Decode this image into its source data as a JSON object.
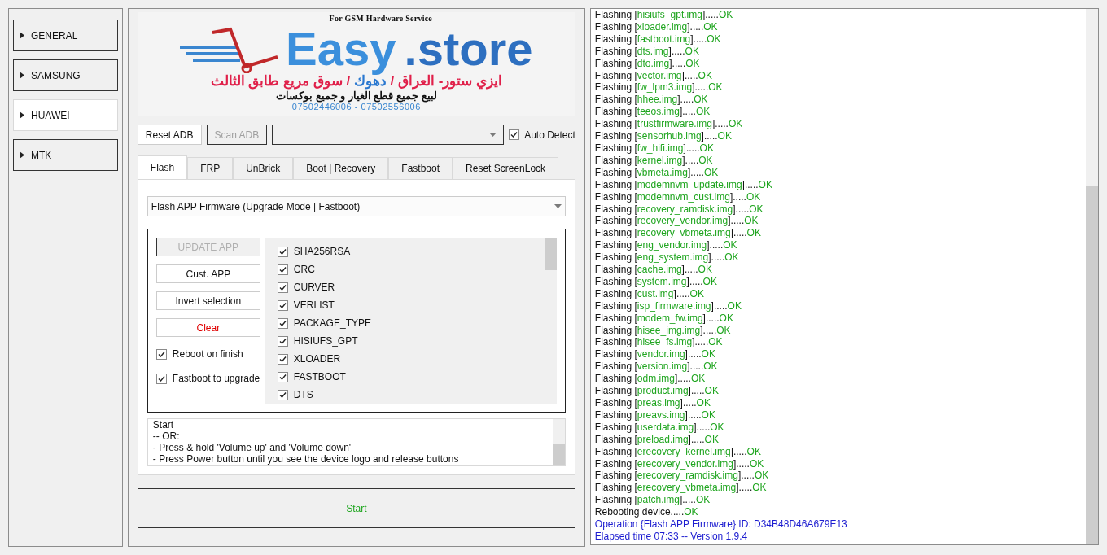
{
  "sidebar": {
    "items": [
      {
        "label": "GENERAL",
        "selected": false
      },
      {
        "label": "SAMSUNG",
        "selected": false
      },
      {
        "label": "HUAWEI",
        "selected": true
      },
      {
        "label": "MTK",
        "selected": false
      }
    ]
  },
  "logo": {
    "tagline": "For GSM Hardware Service",
    "brand": "Easy",
    "brand_suffix": ".store",
    "address_start": "ايزي ستور- العراق /",
    "address_city": "دهوك",
    "address_end": "/ سوق مريع طابق الثالث",
    "slogan": "لبيع جميع قطع الغيار و جميع بوكسات",
    "phones": "07502446006 - 07502556006"
  },
  "toolbar": {
    "buttons": [
      {
        "label": "Reset ADB",
        "disabled": false
      },
      {
        "label": "Scan ADB",
        "disabled": true
      }
    ],
    "auto_detect": {
      "label": "Auto Detect",
      "checked": true
    }
  },
  "tabs": [
    {
      "label": "Flash",
      "selected": true
    },
    {
      "label": "FRP",
      "selected": false
    },
    {
      "label": "UnBrick",
      "selected": false
    },
    {
      "label": "Boot | Recovery",
      "selected": false
    },
    {
      "label": "Fastboot",
      "selected": false
    },
    {
      "label": "Reset ScreenLock",
      "selected": false
    }
  ],
  "mode_select": {
    "value": "Flash APP Firmware (Upgrade Mode | Fastboot)"
  },
  "actions": [
    {
      "label": "UPDATE APP",
      "disabled": true,
      "kind": "normal"
    },
    {
      "label": "Cust. APP",
      "disabled": false,
      "kind": "normal"
    },
    {
      "label": "Invert selection",
      "disabled": false,
      "kind": "normal"
    },
    {
      "label": "Clear",
      "disabled": false,
      "kind": "danger"
    }
  ],
  "options": [
    {
      "label": "Reboot on finish",
      "checked": true
    },
    {
      "label": "Fastboot to upgrade",
      "checked": true
    }
  ],
  "partitions": [
    {
      "label": "SHA256RSA",
      "checked": true
    },
    {
      "label": "CRC",
      "checked": true
    },
    {
      "label": "CURVER",
      "checked": true
    },
    {
      "label": "VERLIST",
      "checked": true
    },
    {
      "label": "PACKAGE_TYPE",
      "checked": true
    },
    {
      "label": "HISIUFS_GPT",
      "checked": true
    },
    {
      "label": "XLOADER",
      "checked": true
    },
    {
      "label": "FASTBOOT",
      "checked": true
    },
    {
      "label": "DTS",
      "checked": true
    }
  ],
  "instructions": [
    "Start",
    "-- OR:",
    "- Press & hold 'Volume up' and 'Volume down'",
    "- Press Power button until you see the device logo and release buttons"
  ],
  "start_button": {
    "label": "Start"
  },
  "log": [
    {
      "kind": "flash",
      "head": "Flashing [",
      "file": "hisiufs_gpt.img",
      "tail": "].....",
      "status": "OK"
    },
    {
      "kind": "flash",
      "head": "Flashing [",
      "file": "xloader.img",
      "tail": "].....",
      "status": "OK"
    },
    {
      "kind": "flash",
      "head": "Flashing [",
      "file": "fastboot.img",
      "tail": "].....",
      "status": "OK"
    },
    {
      "kind": "flash",
      "head": "Flashing [",
      "file": "dts.img",
      "tail": "].....",
      "status": "OK"
    },
    {
      "kind": "flash",
      "head": "Flashing [",
      "file": "dto.img",
      "tail": "].....",
      "status": "OK"
    },
    {
      "kind": "flash",
      "head": "Flashing [",
      "file": "vector.img",
      "tail": "].....",
      "status": "OK"
    },
    {
      "kind": "flash",
      "head": "Flashing [",
      "file": "fw_lpm3.img",
      "tail": "].....",
      "status": "OK"
    },
    {
      "kind": "flash",
      "head": "Flashing [",
      "file": "hhee.img",
      "tail": "].....",
      "status": "OK"
    },
    {
      "kind": "flash",
      "head": "Flashing [",
      "file": "teeos.img",
      "tail": "].....",
      "status": "OK"
    },
    {
      "kind": "flash",
      "head": "Flashing [",
      "file": "trustfirmware.img",
      "tail": "].....",
      "status": "OK"
    },
    {
      "kind": "flash",
      "head": "Flashing [",
      "file": "sensorhub.img",
      "tail": "].....",
      "status": "OK"
    },
    {
      "kind": "flash",
      "head": "Flashing [",
      "file": "fw_hifi.img",
      "tail": "].....",
      "status": "OK"
    },
    {
      "kind": "flash",
      "head": "Flashing [",
      "file": "kernel.img",
      "tail": "].....",
      "status": "OK"
    },
    {
      "kind": "flash",
      "head": "Flashing [",
      "file": "vbmeta.img",
      "tail": "].....",
      "status": "OK"
    },
    {
      "kind": "flash",
      "head": "Flashing [",
      "file": "modemnvm_update.img",
      "tail": "].....",
      "status": "OK"
    },
    {
      "kind": "flash",
      "head": "Flashing [",
      "file": "modemnvm_cust.img",
      "tail": "].....",
      "status": "OK"
    },
    {
      "kind": "flash",
      "head": "Flashing [",
      "file": "recovery_ramdisk.img",
      "tail": "].....",
      "status": "OK"
    },
    {
      "kind": "flash",
      "head": "Flashing [",
      "file": "recovery_vendor.img",
      "tail": "].....",
      "status": "OK"
    },
    {
      "kind": "flash",
      "head": "Flashing [",
      "file": "recovery_vbmeta.img",
      "tail": "].....",
      "status": "OK"
    },
    {
      "kind": "flash",
      "head": "Flashing [",
      "file": "eng_vendor.img",
      "tail": "].....",
      "status": "OK"
    },
    {
      "kind": "flash",
      "head": "Flashing [",
      "file": "eng_system.img",
      "tail": "].....",
      "status": "OK"
    },
    {
      "kind": "flash",
      "head": "Flashing [",
      "file": "cache.img",
      "tail": "].....",
      "status": "OK"
    },
    {
      "kind": "flash",
      "head": "Flashing [",
      "file": "system.img",
      "tail": "].....",
      "status": "OK"
    },
    {
      "kind": "flash",
      "head": "Flashing [",
      "file": "cust.img",
      "tail": "].....",
      "status": "OK"
    },
    {
      "kind": "flash",
      "head": "Flashing [",
      "file": "isp_firmware.img",
      "tail": "].....",
      "status": "OK"
    },
    {
      "kind": "flash",
      "head": "Flashing [",
      "file": "modem_fw.img",
      "tail": "].....",
      "status": "OK"
    },
    {
      "kind": "flash",
      "head": "Flashing [",
      "file": "hisee_img.img",
      "tail": "].....",
      "status": "OK"
    },
    {
      "kind": "flash",
      "head": "Flashing [",
      "file": "hisee_fs.img",
      "tail": "].....",
      "status": "OK"
    },
    {
      "kind": "flash",
      "head": "Flashing [",
      "file": "vendor.img",
      "tail": "].....",
      "status": "OK"
    },
    {
      "kind": "flash",
      "head": "Flashing [",
      "file": "version.img",
      "tail": "].....",
      "status": "OK"
    },
    {
      "kind": "flash",
      "head": "Flashing [",
      "file": "odm.img",
      "tail": "].....",
      "status": "OK"
    },
    {
      "kind": "flash",
      "head": "Flashing [",
      "file": "product.img",
      "tail": "].....",
      "status": "OK"
    },
    {
      "kind": "flash",
      "head": "Flashing [",
      "file": "preas.img",
      "tail": "].....",
      "status": "OK"
    },
    {
      "kind": "flash",
      "head": "Flashing [",
      "file": "preavs.img",
      "tail": "].....",
      "status": "OK"
    },
    {
      "kind": "flash",
      "head": "Flashing [",
      "file": "userdata.img",
      "tail": "].....",
      "status": "OK"
    },
    {
      "kind": "flash",
      "head": "Flashing [",
      "file": "preload.img",
      "tail": "].....",
      "status": "OK"
    },
    {
      "kind": "flash",
      "head": "Flashing [",
      "file": "erecovery_kernel.img",
      "tail": "].....",
      "status": "OK"
    },
    {
      "kind": "flash",
      "head": "Flashing [",
      "file": "erecovery_vendor.img",
      "tail": "].....",
      "status": "OK"
    },
    {
      "kind": "flash",
      "head": "Flashing [",
      "file": "erecovery_ramdisk.img",
      "tail": "].....",
      "status": "OK"
    },
    {
      "kind": "flash",
      "head": "Flashing [",
      "file": "erecovery_vbmeta.img",
      "tail": "].....",
      "status": "OK"
    },
    {
      "kind": "flash",
      "head": "Flashing [",
      "file": "patch.img",
      "tail": "].....",
      "status": "OK"
    },
    {
      "kind": "step",
      "head": "Rebooting device.....",
      "status": "OK"
    },
    {
      "kind": "info",
      "text": "Operation {Flash APP Firmware} ID: D34B48D46A679E13"
    },
    {
      "kind": "info",
      "text": "Elapsed time 07:33 -- Version 1.9.4"
    }
  ]
}
